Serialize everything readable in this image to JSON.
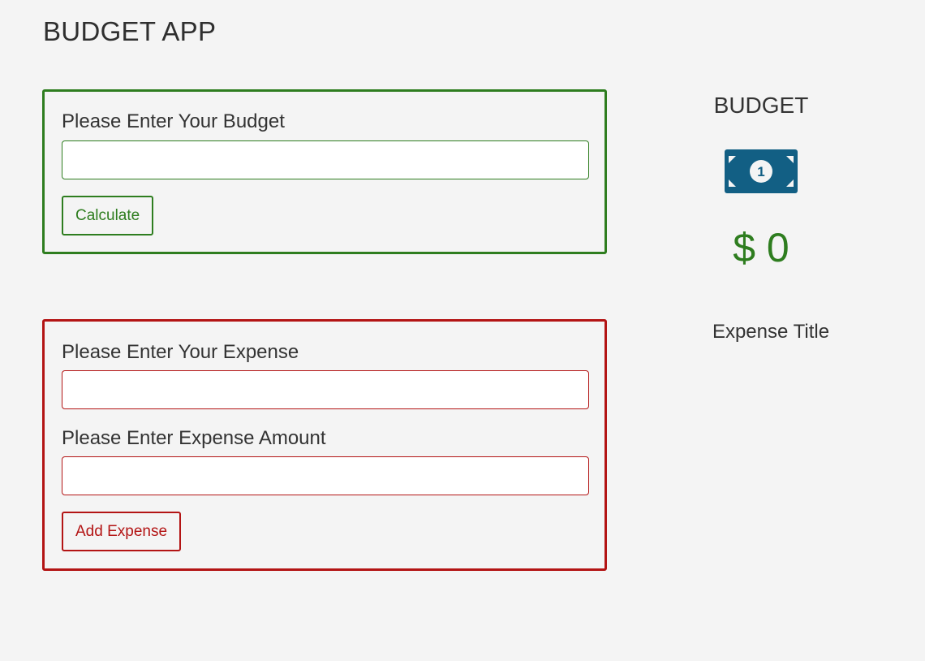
{
  "app": {
    "title": "BUDGET APP"
  },
  "budget_form": {
    "label": "Please Enter Your Budget",
    "input_value": "",
    "button_label": "Calculate"
  },
  "expense_form": {
    "expense_label": "Please Enter Your Expense",
    "expense_value": "",
    "amount_label": "Please Enter Expense Amount",
    "amount_value": "",
    "button_label": "Add Expense"
  },
  "summary": {
    "budget_title": "BUDGET",
    "budget_icon": "money-bill-icon",
    "budget_amount": "$ 0",
    "expense_title": "Expense Title"
  },
  "colors": {
    "budget_accent": "#2e7d1f",
    "expense_accent": "#b31414",
    "icon_color": "#125f84",
    "background": "#f4f4f4"
  }
}
